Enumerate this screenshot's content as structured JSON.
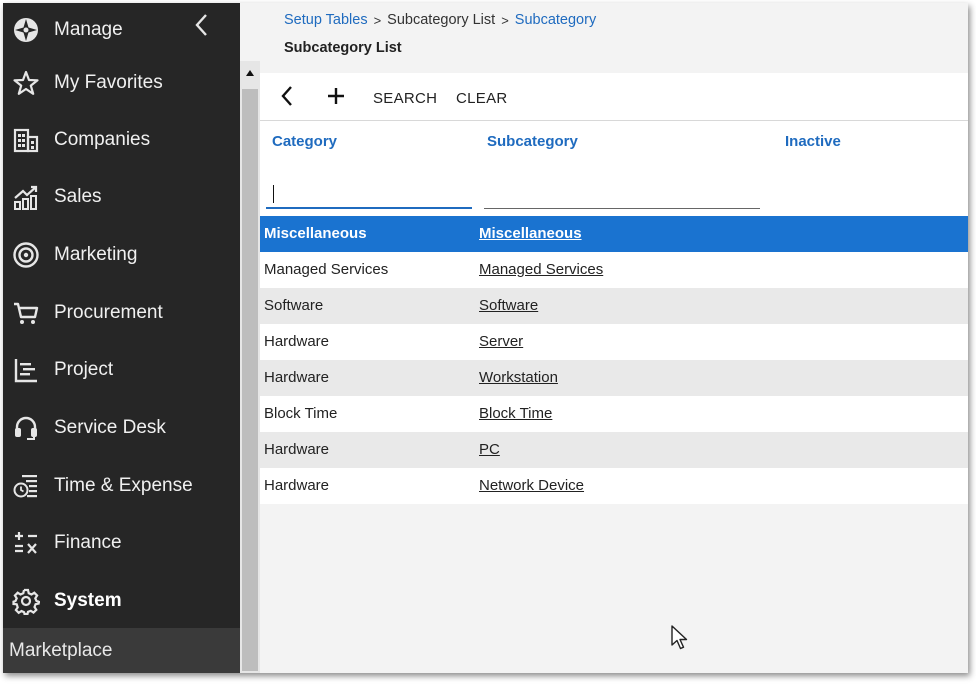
{
  "sidebar": {
    "items": [
      {
        "label": "Manage",
        "icon": "compass-icon"
      },
      {
        "label": "My Favorites",
        "icon": "star-icon"
      },
      {
        "label": "Companies",
        "icon": "building-icon"
      },
      {
        "label": "Sales",
        "icon": "sales-chart-icon"
      },
      {
        "label": "Marketing",
        "icon": "target-icon"
      },
      {
        "label": "Procurement",
        "icon": "cart-icon"
      },
      {
        "label": "Project",
        "icon": "project-list-icon"
      },
      {
        "label": "Service Desk",
        "icon": "headset-icon"
      },
      {
        "label": "Time & Expense",
        "icon": "clock-list-icon"
      },
      {
        "label": "Finance",
        "icon": "math-ops-icon"
      },
      {
        "label": "System",
        "icon": "gear-icon"
      }
    ],
    "footer_label": "Marketplace",
    "collapse_icon": "chevron-left-icon"
  },
  "breadcrumb": {
    "items": [
      "Setup Tables",
      "Subcategory List",
      "Subcategory"
    ],
    "separator": ">"
  },
  "page_title": "Subcategory List",
  "toolbar": {
    "back_icon": "chevron-left-icon",
    "add_icon": "plus-icon",
    "search_label": "SEARCH",
    "clear_label": "CLEAR"
  },
  "table": {
    "columns": [
      "Category",
      "Subcategory",
      "Inactive"
    ],
    "filters": {
      "category": "",
      "subcategory": ""
    },
    "rows": [
      {
        "category": "Miscellaneous",
        "subcategory": "Miscellaneous"
      },
      {
        "category": "Managed Services",
        "subcategory": "Managed Services"
      },
      {
        "category": "Software",
        "subcategory": "Software"
      },
      {
        "category": "Hardware",
        "subcategory": "Server"
      },
      {
        "category": "Hardware",
        "subcategory": "Workstation"
      },
      {
        "category": "Block Time",
        "subcategory": "Block Time"
      },
      {
        "category": "Hardware",
        "subcategory": "PC"
      },
      {
        "category": "Hardware",
        "subcategory": "Network Device"
      }
    ],
    "selected_row": 0
  },
  "colors": {
    "sidebar_bg": "#262626",
    "accent": "#1f6bbf",
    "selected_row": "#1a73d0",
    "alt_row": "#e9e9e9"
  }
}
